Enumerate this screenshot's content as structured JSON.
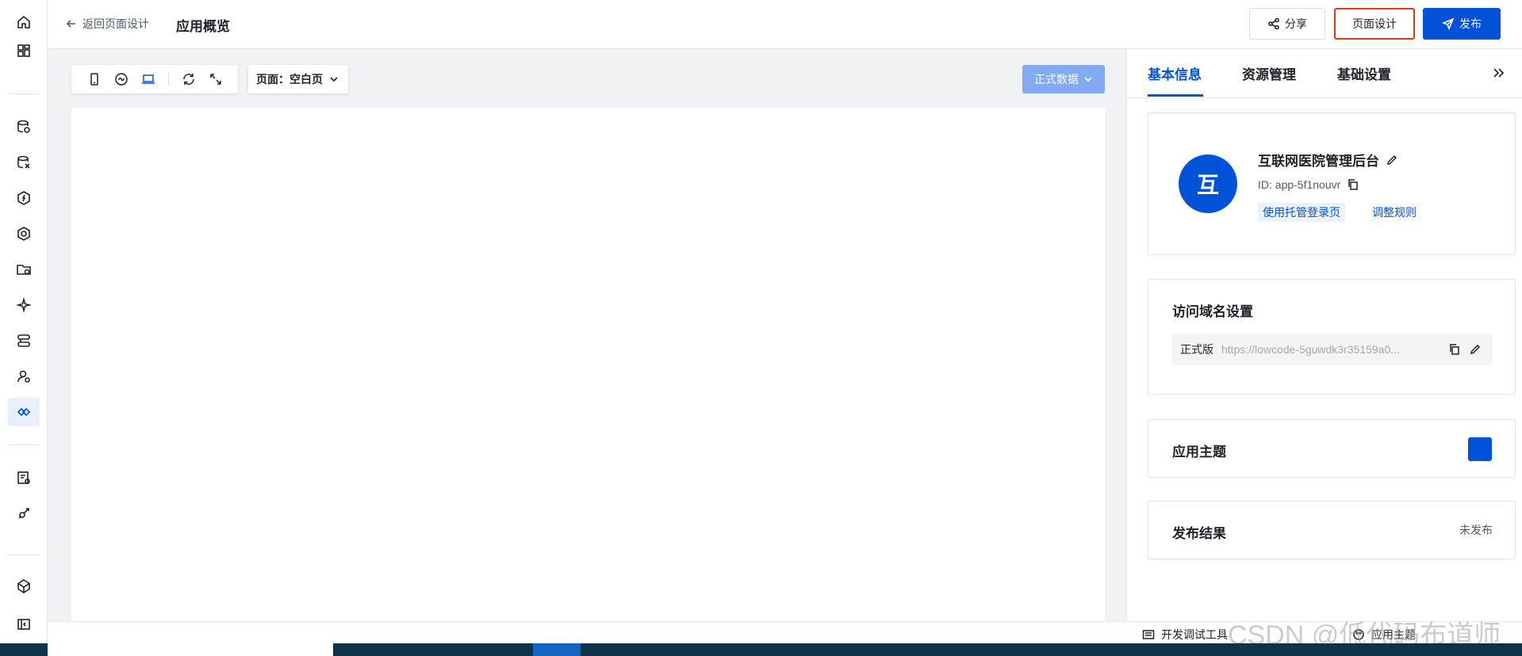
{
  "topbar": {
    "back_label": "返回页面设计",
    "title": "应用概览",
    "share_label": "分享",
    "design_label": "页面设计",
    "publish_label": "发布"
  },
  "canvas": {
    "page_label": "页面：空白页",
    "data_label": "正式数据"
  },
  "panel": {
    "tabs": [
      {
        "label": "基本信息"
      },
      {
        "label": "资源管理"
      },
      {
        "label": "基础设置"
      }
    ],
    "app": {
      "avatar_char": "互",
      "name": "互联网医院管理后台",
      "id": "ID: app-5f1nouvr",
      "login_tag": "使用托管登录页",
      "rule_link": "调整规则"
    },
    "domain": {
      "title": "访问域名设置",
      "env_label": "正式版",
      "url": "https://lowcode-5guwdk3r35159a0..."
    },
    "theme": {
      "title": "应用主题",
      "color": "#0052d9"
    },
    "result": {
      "title": "发布结果",
      "status": "未发布"
    }
  },
  "statusbar": {
    "dev_tools": "开发调试工具",
    "theme": "应用主题"
  },
  "watermark": "CSDN @低代码布道师",
  "colors": {
    "accent": "#0052d9",
    "highlight_border": "#e0391f",
    "data_select_bg": "#82aaf5"
  }
}
